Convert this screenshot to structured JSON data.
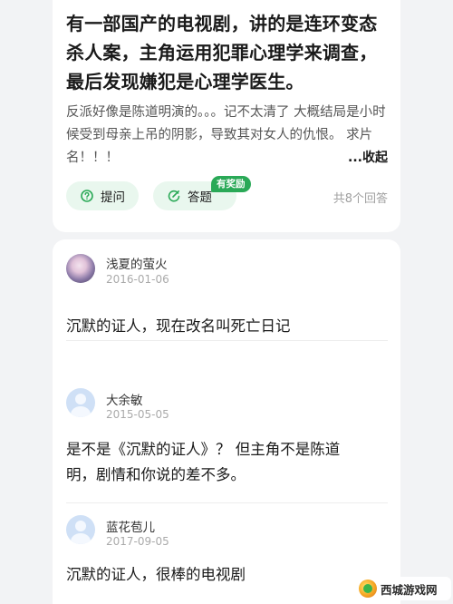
{
  "question": {
    "title": "有一部国产的电视剧，讲的是连环变态杀人案，主角运用犯罪心理学来调查，最后发现嫌犯是心理学医生。",
    "description": "反派好像是陈道明演的。。。记不太清了 大概结局是小时候受到母亲上吊的阴影，导致其对女人的仇恨。 求片名！！！",
    "collapse_label": "...收起",
    "ask_label": "提问",
    "answer_label": "答题",
    "reward_badge": "有奖励",
    "answer_count": "共8个回答"
  },
  "answers": [
    {
      "username": "浅夏的萤火",
      "date": "2016-01-06",
      "text": "沉默的证人，现在改名叫死亡日记"
    },
    {
      "username": "大余敏",
      "date": "2015-05-05",
      "text": "是不是《沉默的证人》？ 但主角不是陈道明，剧情和你说的差不多。"
    },
    {
      "username": "蓝花苞儿",
      "date": "2017-09-05",
      "text": "沉默的证人，很棒的电视剧"
    }
  ],
  "watermark": {
    "text": "西城游戏网"
  },
  "colors": {
    "accent": "#2aa957",
    "pill_bg": "#e9f7ee",
    "page_bg": "#f2f3f5"
  }
}
